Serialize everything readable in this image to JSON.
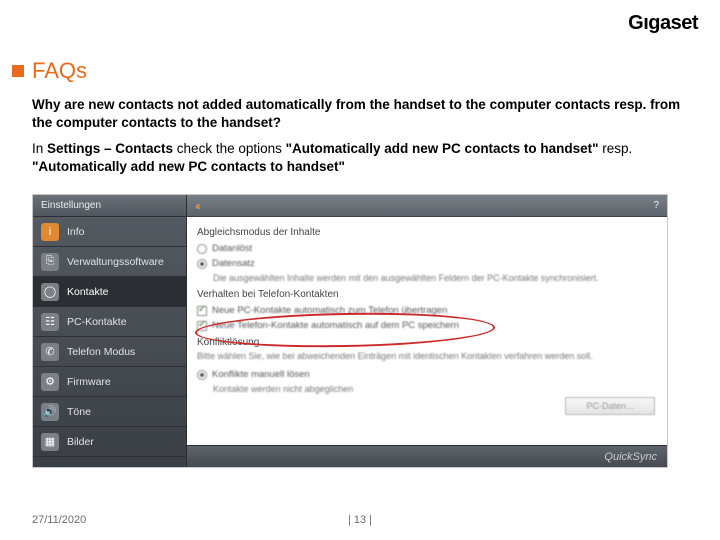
{
  "brand": "Gıgaset",
  "heading": "FAQs",
  "question": "Why are new contacts not added automatically from the handset to the computer contacts resp. from the computer contacts to the handset?",
  "answer": {
    "lead": "In ",
    "bold1": "Settings – Contacts",
    "mid": " check the options ",
    "bold2": "\"Automatically add new PC contacts to handset\"",
    "mid2": " resp. ",
    "bold3": "\"Automatically add new PC contacts to handset\""
  },
  "app": {
    "windowTitle": "Einstellungen",
    "chevron": "‹‹",
    "help": "?",
    "sidebar": [
      {
        "label": "Info",
        "glyph": "i"
      },
      {
        "label": "Verwaltungssoftware",
        "glyph": "⎘"
      },
      {
        "label": "Kontakte",
        "glyph": "◯"
      },
      {
        "label": "PC-Kontakte",
        "glyph": "☷"
      },
      {
        "label": "Telefon Modus",
        "glyph": "✆"
      },
      {
        "label": "Firmware",
        "glyph": "⚙"
      },
      {
        "label": "Töne",
        "glyph": "🔊"
      },
      {
        "label": "Bilder",
        "glyph": "▦"
      }
    ],
    "pane": {
      "sec1Title": "Abgleichsmodus der Inhalte",
      "radio1": "Datanlöst",
      "radio2": "Datensatz",
      "desc1": "Die ausgewählten Inhalte werden mit den ausgewählten Feldern der PC-Kontakte synchronisiert.",
      "sec2Title": "Verhalten bei Telefon-Kontakten",
      "chk1": "Neue PC-Kontakte automatisch zum Telefon übertragen",
      "chk2": "Neue Telefon-Kontakte automatisch auf dem PC speichern",
      "sec3Title": "Konfliktlösung",
      "desc2": "Bitte wählen Sie, wie bei abweichenden Einträgen mit identischen Kontakten verfahren werden soll.",
      "radio3": "Konflikte manuell lösen",
      "desc3": "Kontakte werden nicht abgeglichen",
      "button": "PC-Daten..."
    },
    "footerBrand": "QuickSync"
  },
  "footer": {
    "date": "27/11/2020",
    "page": "| 13 |"
  }
}
